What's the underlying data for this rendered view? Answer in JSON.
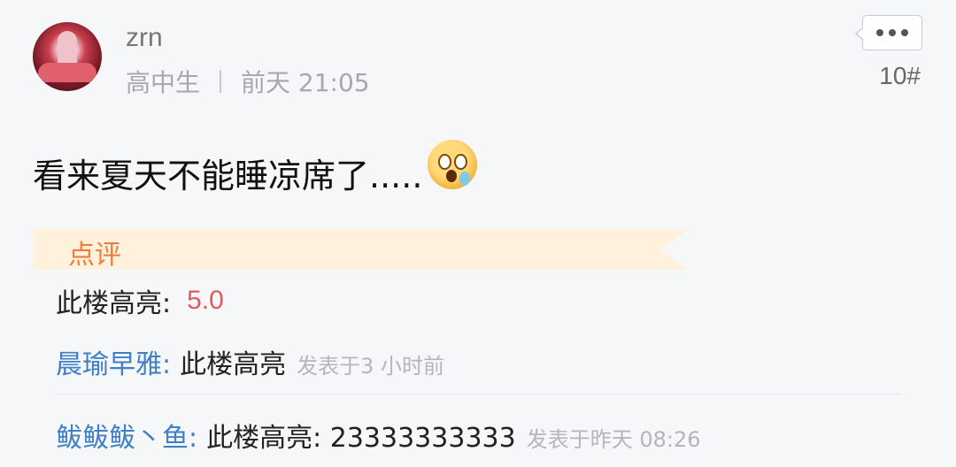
{
  "post": {
    "username": "zrn",
    "user_level": "高中生",
    "time": "前天 21:05",
    "floor": "10#",
    "content": "看来夏天不能睡凉席了.....",
    "content_emoji": "astonished-sweat-emoji"
  },
  "review": {
    "section_label": "点评",
    "rating_label": "此楼高亮:",
    "rating_value": "5.0"
  },
  "comments": [
    {
      "author": "晨瑜早雅",
      "colon": ":",
      "text": "此楼高亮",
      "time": "发表于3 小时前"
    },
    {
      "author": "鲅鲅鲅丶鱼",
      "colon": ":",
      "text": "此楼高亮: 23333333333",
      "time": "发表于昨天 08:26"
    }
  ],
  "colors": {
    "background": "#f6f7f8",
    "author_link": "#3f7fc7",
    "rating_value": "#e45a5a",
    "banner_bg": "#fff1dc",
    "banner_text": "#f07d3c"
  },
  "icons": {
    "more": "more-dots-icon"
  }
}
